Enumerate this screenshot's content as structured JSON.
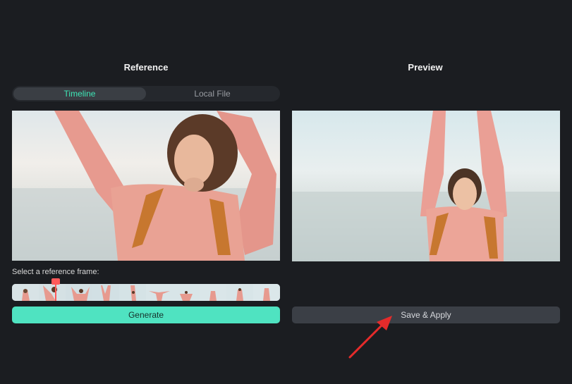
{
  "reference": {
    "title": "Reference",
    "tabs": [
      {
        "label": "Timeline",
        "active": true
      },
      {
        "label": "Local File",
        "active": false
      }
    ],
    "frame_prompt": "Select a reference frame:",
    "generate_label": "Generate"
  },
  "preview": {
    "title": "Preview",
    "save_label": "Save & Apply"
  },
  "colors": {
    "background": "#1b1d21",
    "accent": "#4fe3c1",
    "active_tab_text": "#3ee6b6",
    "playhead": "#ff5a5a",
    "annotation_arrow": "#e52b2b"
  },
  "filmstrip": {
    "frame_count": 10,
    "selected_frame": 2
  }
}
